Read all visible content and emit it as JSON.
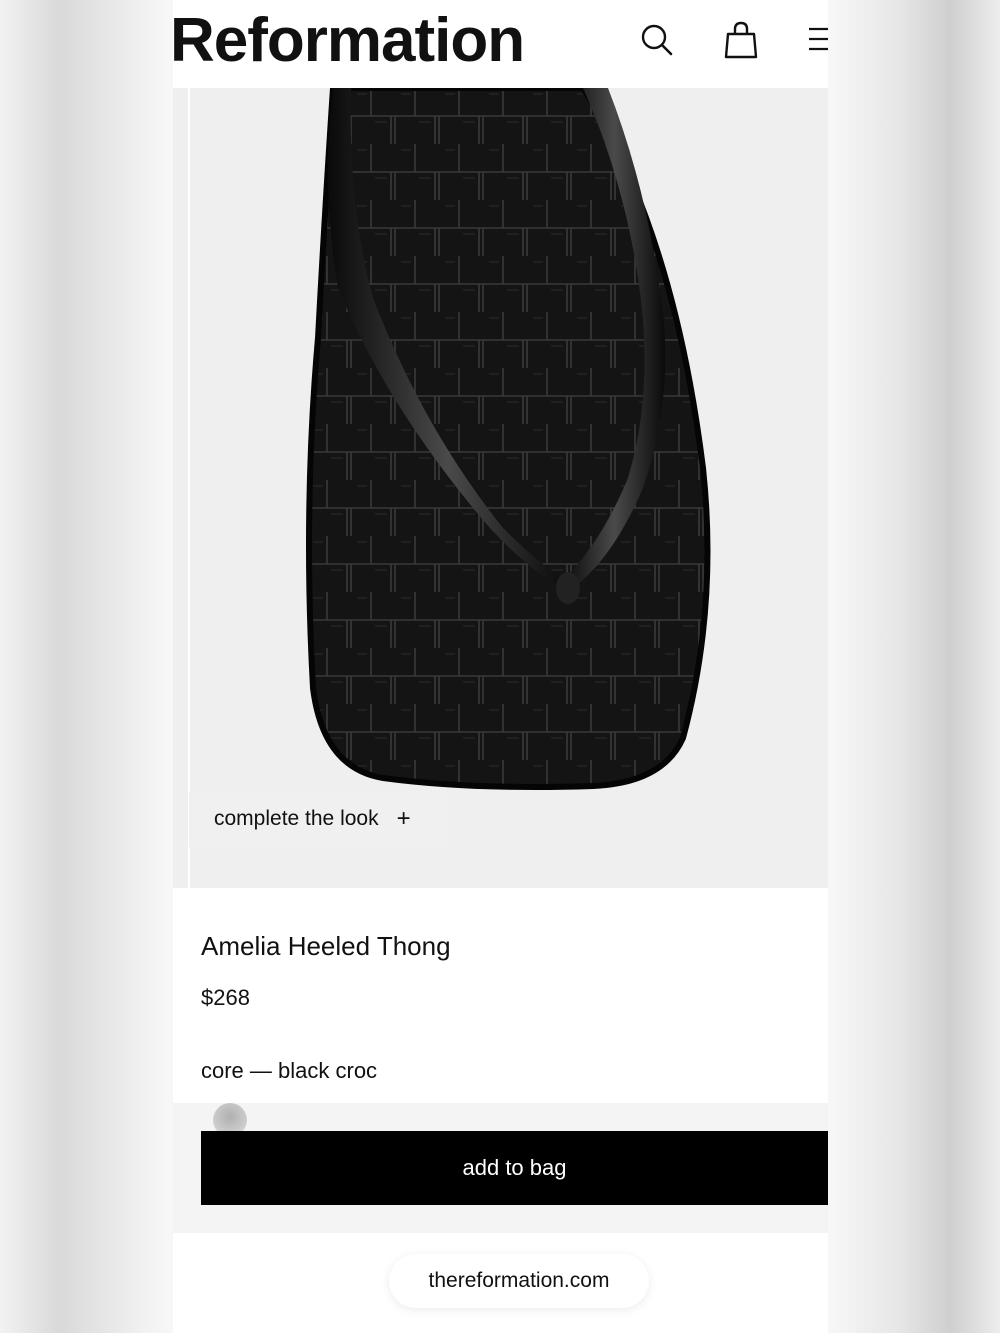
{
  "brand": {
    "logo": "Reformation"
  },
  "header_icons": [
    "search-icon",
    "shopping-bag-icon",
    "menu-icon"
  ],
  "hero": {
    "image": "black croc heeled thong sandal",
    "complete_look_label": "complete the look",
    "complete_look_icon": "+"
  },
  "product": {
    "name": "Amelia Heeled Thong",
    "price": "$268",
    "variant": "core — black croc"
  },
  "actions": {
    "add_to_bag": "add to bag"
  },
  "browser": {
    "url": "thereformation.com"
  },
  "colors": {
    "button": "#000000",
    "background": "#ffffff",
    "hero": "#efefef",
    "text": "#111111"
  }
}
